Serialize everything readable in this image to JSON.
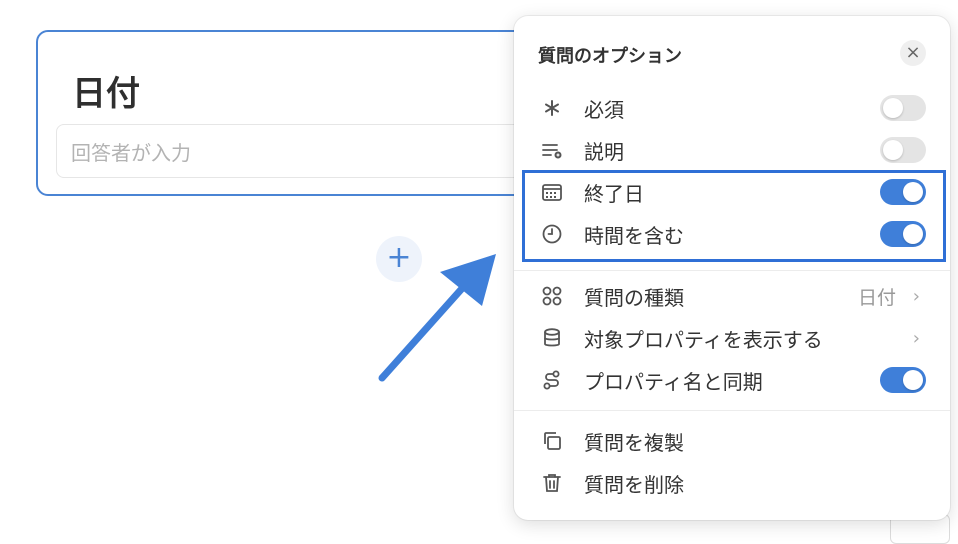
{
  "card": {
    "title": "日付",
    "answer_placeholder": "回答者が入力"
  },
  "add_button": {
    "label": "+"
  },
  "panel": {
    "title": "質問のオプション",
    "close_label": "×",
    "rows": {
      "required": {
        "label": "必須",
        "icon": "asterisk-icon",
        "state": "off"
      },
      "description": {
        "label": "説明",
        "icon": "description-icon",
        "state": "off"
      },
      "end_date": {
        "label": "終了日",
        "icon": "calendar-icon",
        "state": "on"
      },
      "include_time": {
        "label": "時間を含む",
        "icon": "clock-icon",
        "state": "on"
      },
      "question_type": {
        "label": "質問の種類",
        "icon": "grid-icon",
        "value": "日付"
      },
      "target_property": {
        "label": "対象プロパティを表示する",
        "icon": "database-icon"
      },
      "sync_property": {
        "label": "プロパティ名と同期",
        "icon": "sync-icon",
        "state": "on"
      },
      "duplicate": {
        "label": "質問を複製",
        "icon": "duplicate-icon"
      },
      "delete": {
        "label": "質問を削除",
        "icon": "trash-icon"
      }
    },
    "chevron": "›"
  },
  "colors": {
    "accent": "#3f7fd9",
    "card_border": "#4a84d4",
    "highlight": "#2f6fd6",
    "toggle_off": "#e4e4e4"
  }
}
